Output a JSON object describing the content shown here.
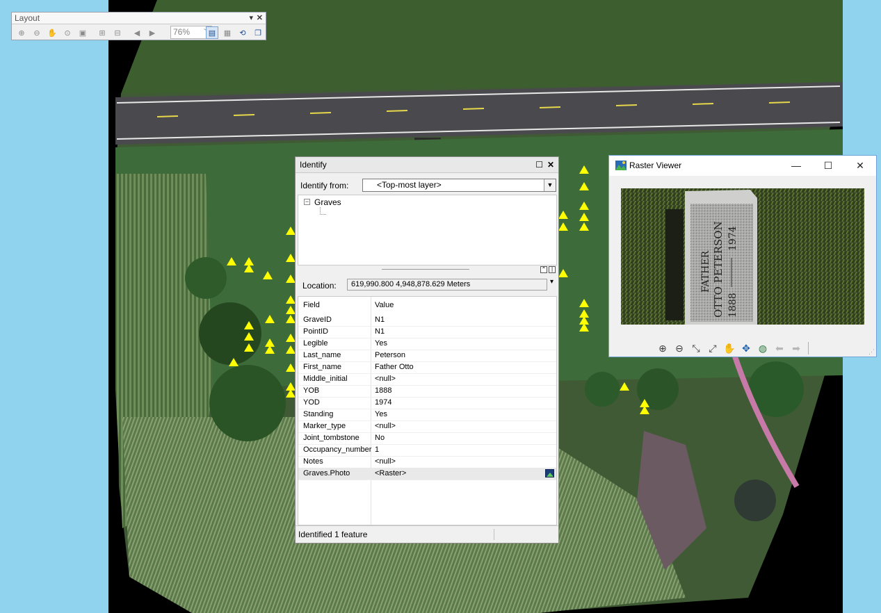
{
  "layout_toolbar": {
    "title": "Layout",
    "zoom_value": "76%",
    "buttons": [
      "zoom-in-icon",
      "zoom-out-icon",
      "pan-icon",
      "zoom-whole-page-icon",
      "zoom-100-icon",
      "fixed-zoom-in-icon",
      "fixed-zoom-out-icon",
      "go-back-icon",
      "go-forward-icon",
      "toggle-draft-mode-icon",
      "focus-data-frame-icon",
      "change-layout-icon",
      "data-driven-pages-icon"
    ]
  },
  "identify": {
    "title": "Identify",
    "identify_from_label": "Identify from:",
    "identify_from_value": "<Top-most layer>",
    "tree_layer": "Graves",
    "location_label": "Location:",
    "location_value": "619,990.800  4,948,878.629 Meters",
    "col_field": "Field",
    "col_value": "Value",
    "fields": [
      {
        "k": "GraveID",
        "v": "N1"
      },
      {
        "k": "PointID",
        "v": "N1"
      },
      {
        "k": "Legible",
        "v": "Yes"
      },
      {
        "k": "Last_name",
        "v": "Peterson"
      },
      {
        "k": "First_name",
        "v": "Father Otto"
      },
      {
        "k": "Middle_initial",
        "v": "<null>"
      },
      {
        "k": "YOB",
        "v": "1888"
      },
      {
        "k": "YOD",
        "v": "1974"
      },
      {
        "k": "Standing",
        "v": "Yes"
      },
      {
        "k": "Marker_type",
        "v": "<null>"
      },
      {
        "k": "Joint_tombstone",
        "v": "No"
      },
      {
        "k": "Occupancy_number",
        "v": "1"
      },
      {
        "k": "Notes",
        "v": "<null>"
      },
      {
        "k": "Graves.Photo",
        "v": "<Raster>"
      }
    ],
    "status": "Identified 1 feature"
  },
  "raster_viewer": {
    "title": "Raster Viewer",
    "stone_text": [
      "FATHER",
      "OTTO PETERSON",
      "1888",
      "1974"
    ]
  },
  "colors": {
    "marker": "#ffff00",
    "desktop": "#8fd3ee"
  }
}
